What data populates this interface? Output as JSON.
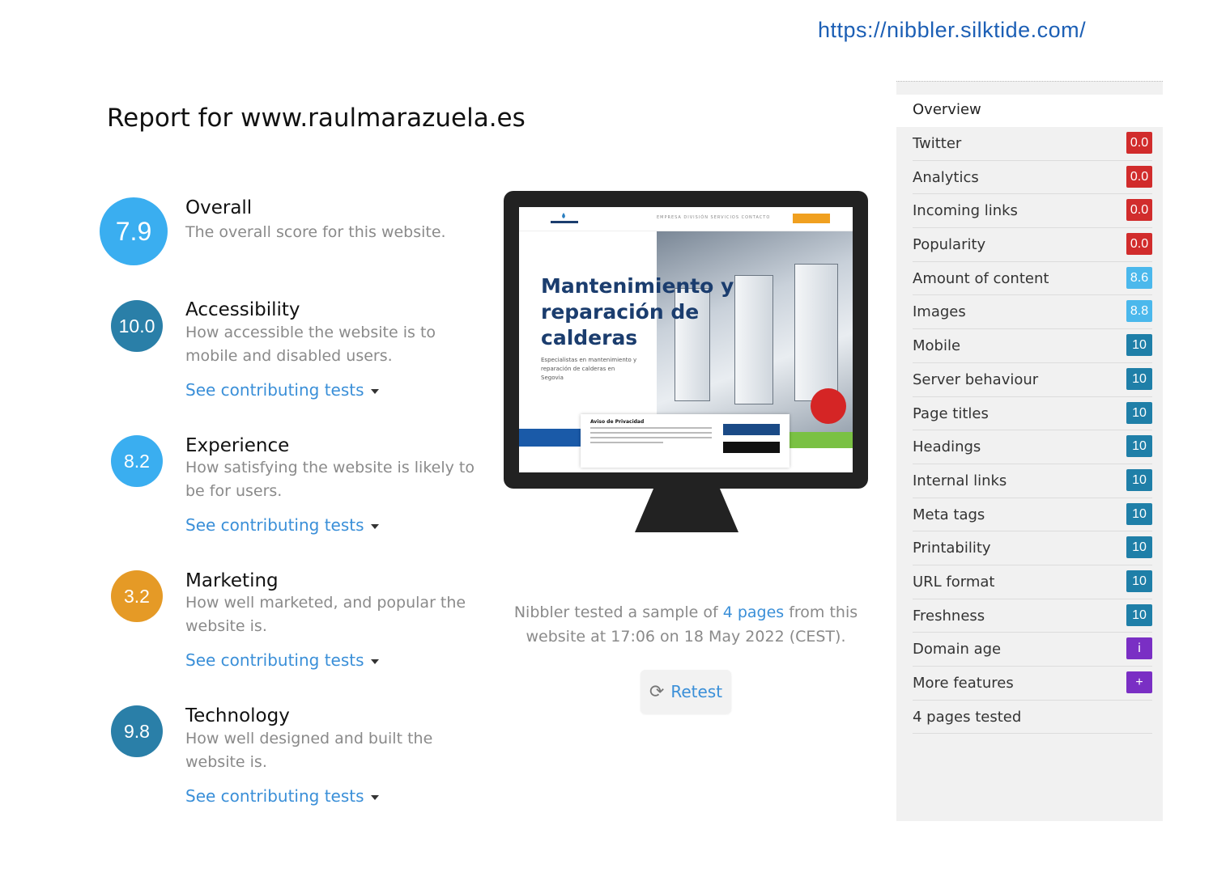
{
  "url": "https://nibbler.silktide.com/",
  "report_title": "Report for www.raulmarazuela.es",
  "colors": {
    "overall": "#3aaef0",
    "accessibility": "#2a7fa8",
    "experience": "#3aaef0",
    "marketing": "#e59a26",
    "technology": "#2a7fa8",
    "badge_red": "#d12c2c",
    "badge_lightblue": "#4bb8ec",
    "badge_teal": "#1f7fa8",
    "badge_purple": "#7a2fc4"
  },
  "scores": [
    {
      "key": "overall",
      "value": "7.9",
      "title": "Overall",
      "description": "The overall score for this website.",
      "link": ""
    },
    {
      "key": "accessibility",
      "value": "10.0",
      "title": "Accessibility",
      "description": "How accessible the website is to mobile and disabled users.",
      "link": "See contributing tests"
    },
    {
      "key": "experience",
      "value": "8.2",
      "title": "Experience",
      "description": "How satisfying the website is likely to be for users.",
      "link": "See contributing tests"
    },
    {
      "key": "marketing",
      "value": "3.2",
      "title": "Marketing",
      "description": "How well marketed, and popular the website is.",
      "link": "See contributing tests"
    },
    {
      "key": "technology",
      "value": "9.8",
      "title": "Technology",
      "description": "How well designed and built the website is.",
      "link": "See contributing tests"
    }
  ],
  "preview": {
    "hero_title": "Mantenimiento y reparación de calderas",
    "hero_subtitle": "Especialistas en mantenimiento y reparación de calderas en Segovia",
    "nav_links": "EMPRESA  DIVISIÓN  SERVICIOS  CONTACTO",
    "logo_text": "marazuela",
    "cookie_title": "Aviso de Privacidad"
  },
  "tested": {
    "prefix": "Nibbler tested a sample of ",
    "link": "4 pages",
    "suffix": " from this website at 17:06 on 18 May 2022 (CEST)."
  },
  "retest_label": "Retest",
  "sidebar": {
    "overview": "Overview",
    "items": [
      {
        "label": "Twitter",
        "badge": "0.0",
        "color": "red"
      },
      {
        "label": "Analytics",
        "badge": "0.0",
        "color": "red"
      },
      {
        "label": "Incoming links",
        "badge": "0.0",
        "color": "red"
      },
      {
        "label": "Popularity",
        "badge": "0.0",
        "color": "red"
      },
      {
        "label": "Amount of content",
        "badge": "8.6",
        "color": "lightblue"
      },
      {
        "label": "Images",
        "badge": "8.8",
        "color": "lightblue"
      },
      {
        "label": "Mobile",
        "badge": "10",
        "color": "teal"
      },
      {
        "label": "Server behaviour",
        "badge": "10",
        "color": "teal"
      },
      {
        "label": "Page titles",
        "badge": "10",
        "color": "teal"
      },
      {
        "label": "Headings",
        "badge": "10",
        "color": "teal"
      },
      {
        "label": "Internal links",
        "badge": "10",
        "color": "teal"
      },
      {
        "label": "Meta tags",
        "badge": "10",
        "color": "teal"
      },
      {
        "label": "Printability",
        "badge": "10",
        "color": "teal"
      },
      {
        "label": "URL format",
        "badge": "10",
        "color": "teal"
      },
      {
        "label": "Freshness",
        "badge": "10",
        "color": "teal"
      },
      {
        "label": "Domain age",
        "badge": "i",
        "color": "purple"
      },
      {
        "label": "More features",
        "badge": "+",
        "color": "purple"
      },
      {
        "label": "4 pages tested",
        "badge": "",
        "color": ""
      }
    ]
  }
}
